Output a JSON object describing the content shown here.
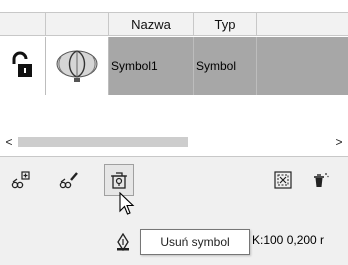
{
  "table": {
    "headers": [
      "",
      "",
      "Nazwa",
      "Typ",
      ""
    ],
    "rows": [
      {
        "name": "Symbol1",
        "type": "Symbol"
      }
    ]
  },
  "scroll": {
    "left_arrow": "<",
    "right_arrow": ">"
  },
  "toolbar": {
    "buttons": [
      {
        "icon": "add-symbol-icon"
      },
      {
        "icon": "edit-symbol-icon"
      },
      {
        "icon": "delete-symbol-icon"
      },
      {
        "icon": "select-icon"
      },
      {
        "icon": "trash-icon"
      }
    ]
  },
  "tooltip": {
    "text": "Usuń symbol"
  },
  "status": {
    "text": "K:100 0,200 r"
  }
}
